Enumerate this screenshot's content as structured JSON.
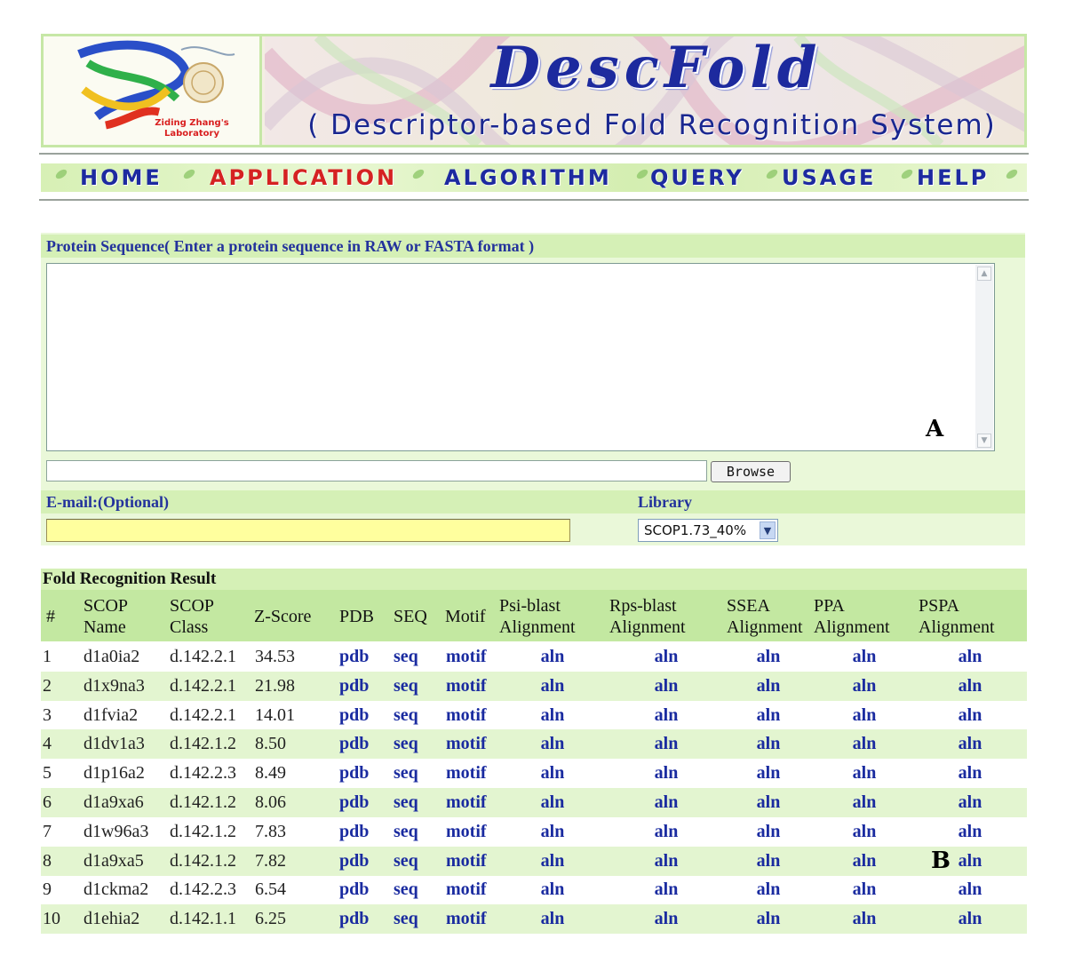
{
  "header": {
    "lab_name": "Ziding Zhang's Laboratory",
    "title": "DescFold",
    "subtitle": "( Descriptor-based  Fold  Recognition System)"
  },
  "nav": {
    "items": [
      {
        "label": "HOME"
      },
      {
        "label": "APPLICATION"
      },
      {
        "label": "ALGORITHM"
      },
      {
        "label": "QUERY"
      },
      {
        "label": "USAGE"
      },
      {
        "label": "HELP"
      }
    ],
    "active": "APPLICATION"
  },
  "form": {
    "sequence_label": "Protein Sequence( Enter a protein sequence in RAW or FASTA format )",
    "sequence_value": "",
    "file_value": "",
    "browse_label": "Browse",
    "email_label": "E-mail:(Optional)",
    "email_value": "",
    "library_label": "Library",
    "library_selected": "SCOP1.73_40%"
  },
  "markers": {
    "a": "A",
    "b": "B"
  },
  "results": {
    "title": "Fold Recognition Result",
    "columns": [
      {
        "line1": "#",
        "line2": ""
      },
      {
        "line1": "SCOP",
        "line2": "Name"
      },
      {
        "line1": "SCOP",
        "line2": "Class"
      },
      {
        "line1": "Z-Score",
        "line2": ""
      },
      {
        "line1": "PDB",
        "line2": ""
      },
      {
        "line1": "SEQ",
        "line2": ""
      },
      {
        "line1": "Motif",
        "line2": ""
      },
      {
        "line1": "Psi-blast",
        "line2": "Alignment"
      },
      {
        "line1": "Rps-blast",
        "line2": "Alignment"
      },
      {
        "line1": "SSEA",
        "line2": "Alignment"
      },
      {
        "line1": "PPA",
        "line2": "Alignment"
      },
      {
        "line1": "PSPA",
        "line2": "Alignment"
      }
    ],
    "link_labels": {
      "pdb": "pdb",
      "seq": "seq",
      "motif": "motif",
      "aln": "aln"
    },
    "rows": [
      {
        "num": "1",
        "name": "d1a0ia2",
        "class": "d.142.2.1",
        "zscore": "34.53"
      },
      {
        "num": "2",
        "name": "d1x9na3",
        "class": "d.142.2.1",
        "zscore": "21.98"
      },
      {
        "num": "3",
        "name": "d1fvia2",
        "class": "d.142.2.1",
        "zscore": "14.01"
      },
      {
        "num": "4",
        "name": "d1dv1a3",
        "class": "d.142.1.2",
        "zscore": "8.50"
      },
      {
        "num": "5",
        "name": "d1p16a2",
        "class": "d.142.2.3",
        "zscore": "8.49"
      },
      {
        "num": "6",
        "name": "d1a9xa6",
        "class": "d.142.1.2",
        "zscore": "8.06"
      },
      {
        "num": "7",
        "name": "d1w96a3",
        "class": "d.142.1.2",
        "zscore": "7.83"
      },
      {
        "num": "8",
        "name": "d1a9xa5",
        "class": "d.142.1.2",
        "zscore": "7.82"
      },
      {
        "num": "9",
        "name": "d1ckma2",
        "class": "d.142.2.3",
        "zscore": "6.54"
      },
      {
        "num": "10",
        "name": "d1ehia2",
        "class": "d.142.1.1",
        "zscore": "6.25"
      }
    ]
  },
  "colors": {
    "brand_blue": "#1d2a9e",
    "active_red": "#d52222",
    "panel_green": "#d5f0b6",
    "header_green": "#c3e8a1",
    "link_blue": "#1a2ba0"
  }
}
